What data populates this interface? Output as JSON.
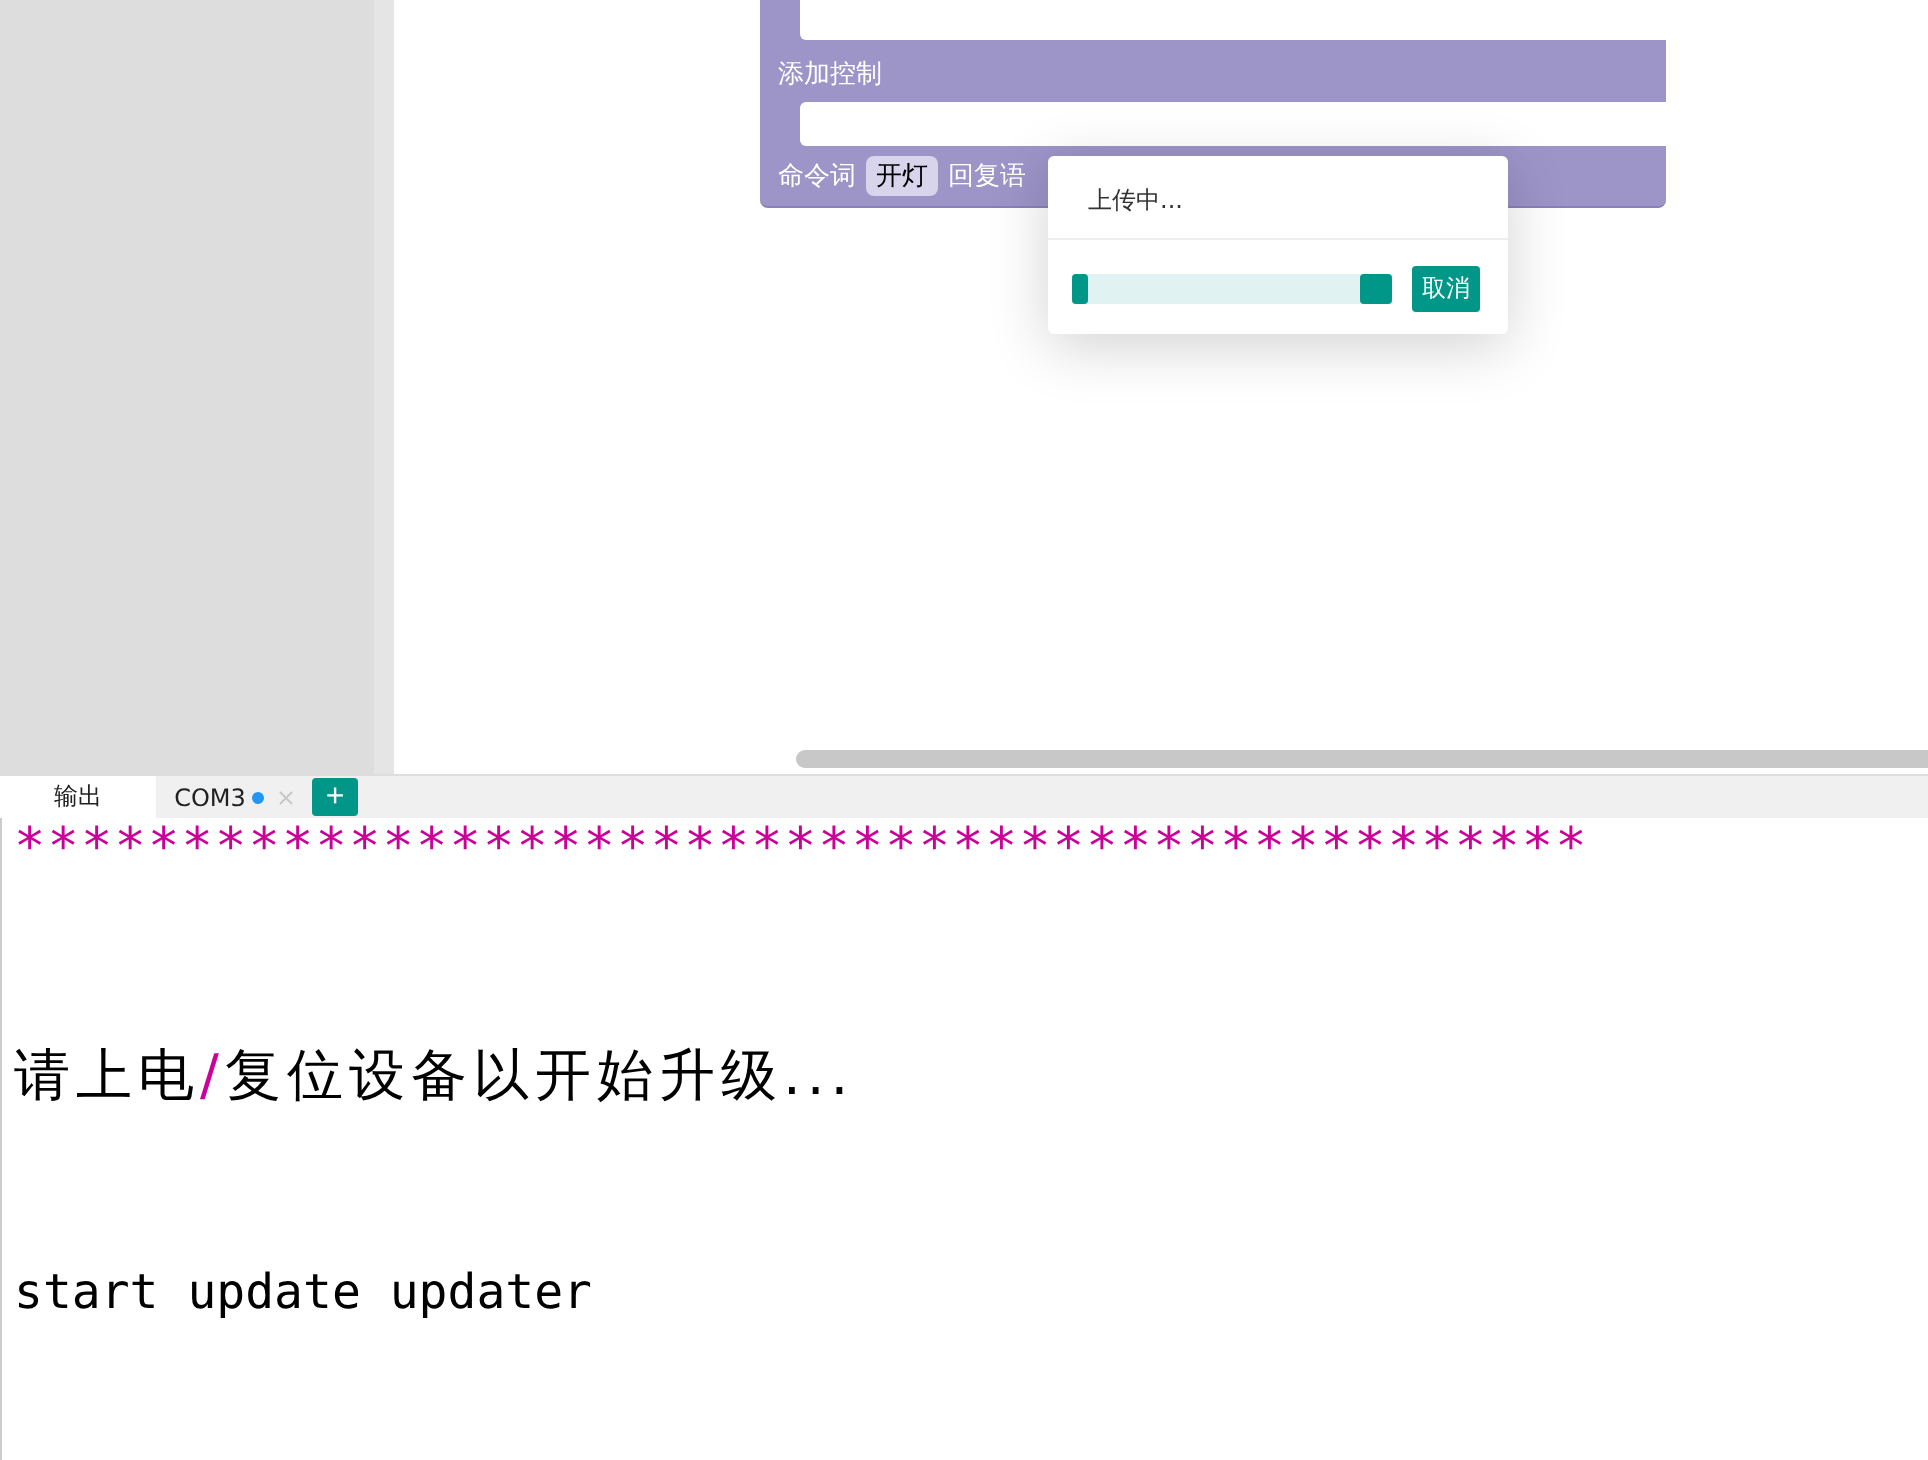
{
  "blocks": {
    "section_label": "添加控制",
    "command_label": "命令词",
    "command_value": "开灯",
    "reply_label": "回复语"
  },
  "dialog": {
    "message": "上传中...",
    "progress": {
      "level": 0.05
    },
    "cancel": "取消"
  },
  "tabs": [
    {
      "label": "输出",
      "selected": true,
      "closable": false,
      "status_dot": false
    },
    {
      "label": "COM3",
      "selected": false,
      "closable": true,
      "status_dot": true
    }
  ],
  "add_tab": "+",
  "console": {
    "lines": [
      {
        "segments": [
          {
            "text": "***********************************************",
            "kind": "accent"
          }
        ],
        "kind": "latin"
      },
      {
        "segments": [
          {
            "text": "请上电",
            "kind": "plain"
          },
          {
            "text": "/",
            "kind": "accent"
          },
          {
            "text": "复位设备以开始升级...",
            "kind": "plain"
          }
        ],
        "kind": "cjk"
      },
      {
        "segments": [
          {
            "text": "start update updater",
            "kind": "plain"
          }
        ],
        "kind": "latin"
      }
    ]
  }
}
